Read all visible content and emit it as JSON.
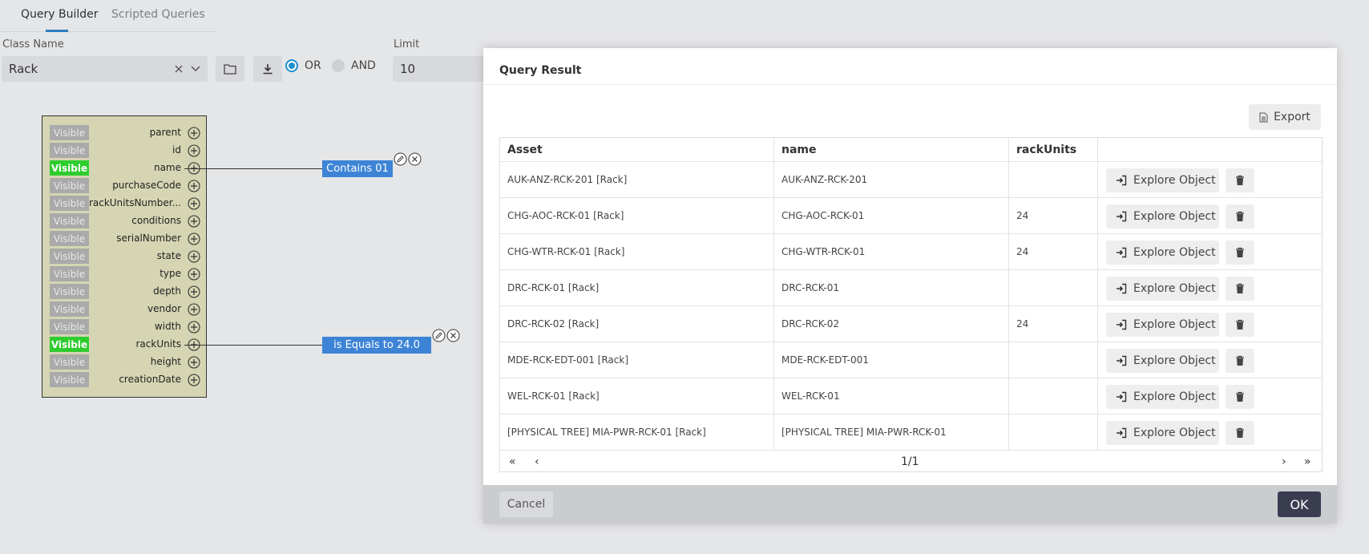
{
  "tabs": [
    {
      "label": "Query Builder",
      "active": true
    },
    {
      "label": "Scripted Queries",
      "active": false
    }
  ],
  "form": {
    "class_name_label": "Class Name",
    "class_name_value": "Rack",
    "limit_label": "Limit",
    "limit_value": "10",
    "radio_or": "OR",
    "radio_and": "AND"
  },
  "class_box": {
    "visible_label": "Visible",
    "properties": [
      {
        "name": "parent",
        "visible": false
      },
      {
        "name": "id",
        "visible": false
      },
      {
        "name": "name",
        "visible": true
      },
      {
        "name": "purchaseCode",
        "visible": false
      },
      {
        "name": "rackUnitsNumber...",
        "visible": false
      },
      {
        "name": "conditions",
        "visible": false
      },
      {
        "name": "serialNumber",
        "visible": false
      },
      {
        "name": "state",
        "visible": false
      },
      {
        "name": "type",
        "visible": false
      },
      {
        "name": "depth",
        "visible": false
      },
      {
        "name": "vendor",
        "visible": false
      },
      {
        "name": "width",
        "visible": false
      },
      {
        "name": "rackUnits",
        "visible": true
      },
      {
        "name": "height",
        "visible": false
      },
      {
        "name": "creationDate",
        "visible": false
      }
    ]
  },
  "filters": [
    {
      "label": "Contains 01"
    },
    {
      "label": "is Equals to 24.0"
    }
  ],
  "modal": {
    "title": "Query Result",
    "export_label": "Export",
    "columns": [
      "Asset",
      "name",
      "rackUnits",
      ""
    ],
    "explore_label": "Explore Object",
    "rows": [
      {
        "asset": "AUK-ANZ-RCK-201 [Rack]",
        "name": "AUK-ANZ-RCK-201",
        "rack_units": ""
      },
      {
        "asset": "CHG-AOC-RCK-01 [Rack]",
        "name": "CHG-AOC-RCK-01",
        "rack_units": "24"
      },
      {
        "asset": "CHG-WTR-RCK-01 [Rack]",
        "name": "CHG-WTR-RCK-01",
        "rack_units": "24"
      },
      {
        "asset": "DRC-RCK-01 [Rack]",
        "name": "DRC-RCK-01",
        "rack_units": ""
      },
      {
        "asset": "DRC-RCK-02 [Rack]",
        "name": "DRC-RCK-02",
        "rack_units": "24"
      },
      {
        "asset": "MDE-RCK-EDT-001 [Rack]",
        "name": "MDE-RCK-EDT-001",
        "rack_units": ""
      },
      {
        "asset": "WEL-RCK-01 [Rack]",
        "name": "WEL-RCK-01",
        "rack_units": ""
      },
      {
        "asset": "[PHYSICAL TREE] MIA-PWR-RCK-01 [Rack]",
        "name": "[PHYSICAL TREE] MIA-PWR-RCK-01",
        "rack_units": ""
      }
    ],
    "pagination": {
      "first": "«",
      "prev": "‹",
      "page_info": "1/1",
      "next": "›",
      "last": "»"
    },
    "cancel_label": "Cancel",
    "ok_label": "OK"
  },
  "icons": {
    "clear": "close-icon",
    "dropdown": "chevron-down-icon",
    "open": "folder-icon",
    "download": "download-icon",
    "add": "plus-circle-icon",
    "edit": "pencil-icon",
    "remove": "close-circle-icon",
    "export": "file-icon",
    "explore": "sign-in-icon",
    "delete": "trash-icon"
  }
}
